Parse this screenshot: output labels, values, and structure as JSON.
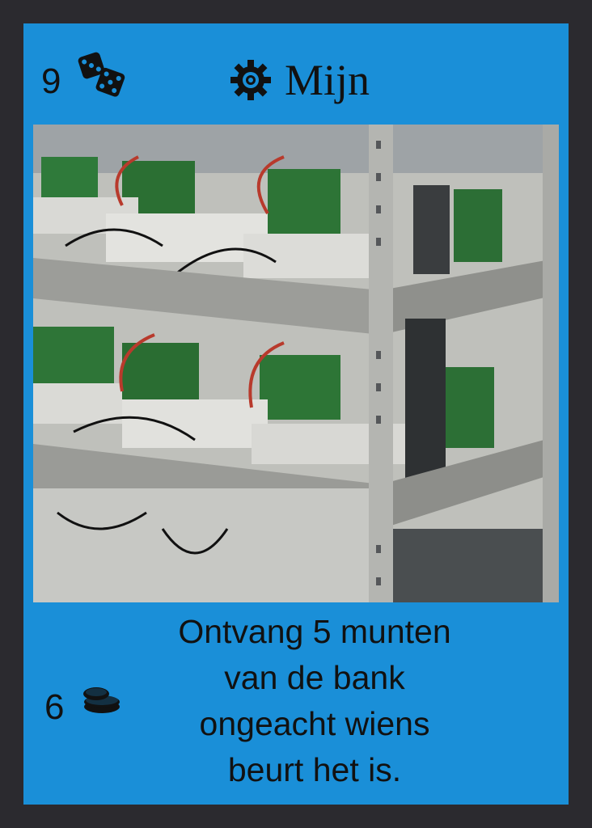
{
  "card": {
    "dice_value": "9",
    "title": "Mijn",
    "coin_value": "6",
    "description_lines": [
      "Ontvang 5 munten",
      "van de bank",
      "ongeacht wiens",
      "beurt het is."
    ],
    "icons": {
      "dice": "dice-icon",
      "gear": "gear-icon",
      "coins": "coins-icon"
    },
    "colors": {
      "card_background": "#1a8fd8",
      "border": "#2b2a2f",
      "text": "#111111"
    },
    "image": "photo of cryptocurrency mining rigs on metal shelving"
  }
}
